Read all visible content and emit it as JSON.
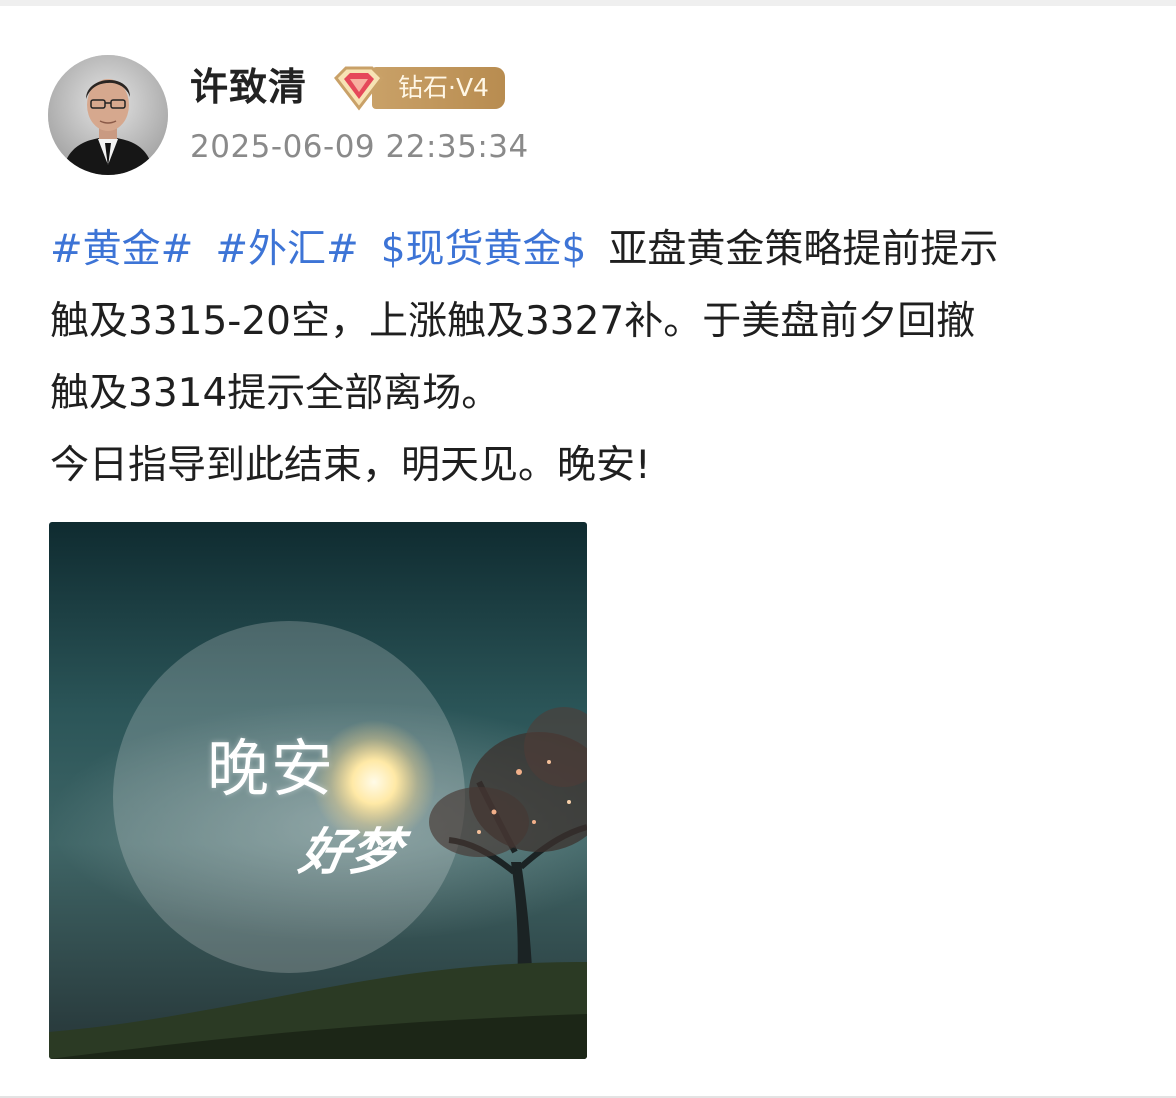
{
  "author": {
    "name": "许致清",
    "badge_label": "钻石·V4",
    "avatar_icon": "avatar-portrait",
    "badge_icon": "diamond-gem-icon"
  },
  "post": {
    "timestamp": "2025-06-09 22:35:34",
    "tags": [
      "#黄金#",
      "#外汇#",
      "$现货黄金$"
    ],
    "line1_text": "亚盘黄金策略提前提示",
    "line2": "触及3315-20空，上涨触及3327补。于美盘前夕回撤",
    "line3": "触及3314提示全部离场。",
    "line4": "今日指导到此结束，明天见。晚安!"
  },
  "image": {
    "title": "晚安",
    "subtitle": "好梦"
  },
  "colors": {
    "tag": "#3d74d6",
    "timestamp": "#8a8a8a",
    "badge": "#c9a168"
  }
}
